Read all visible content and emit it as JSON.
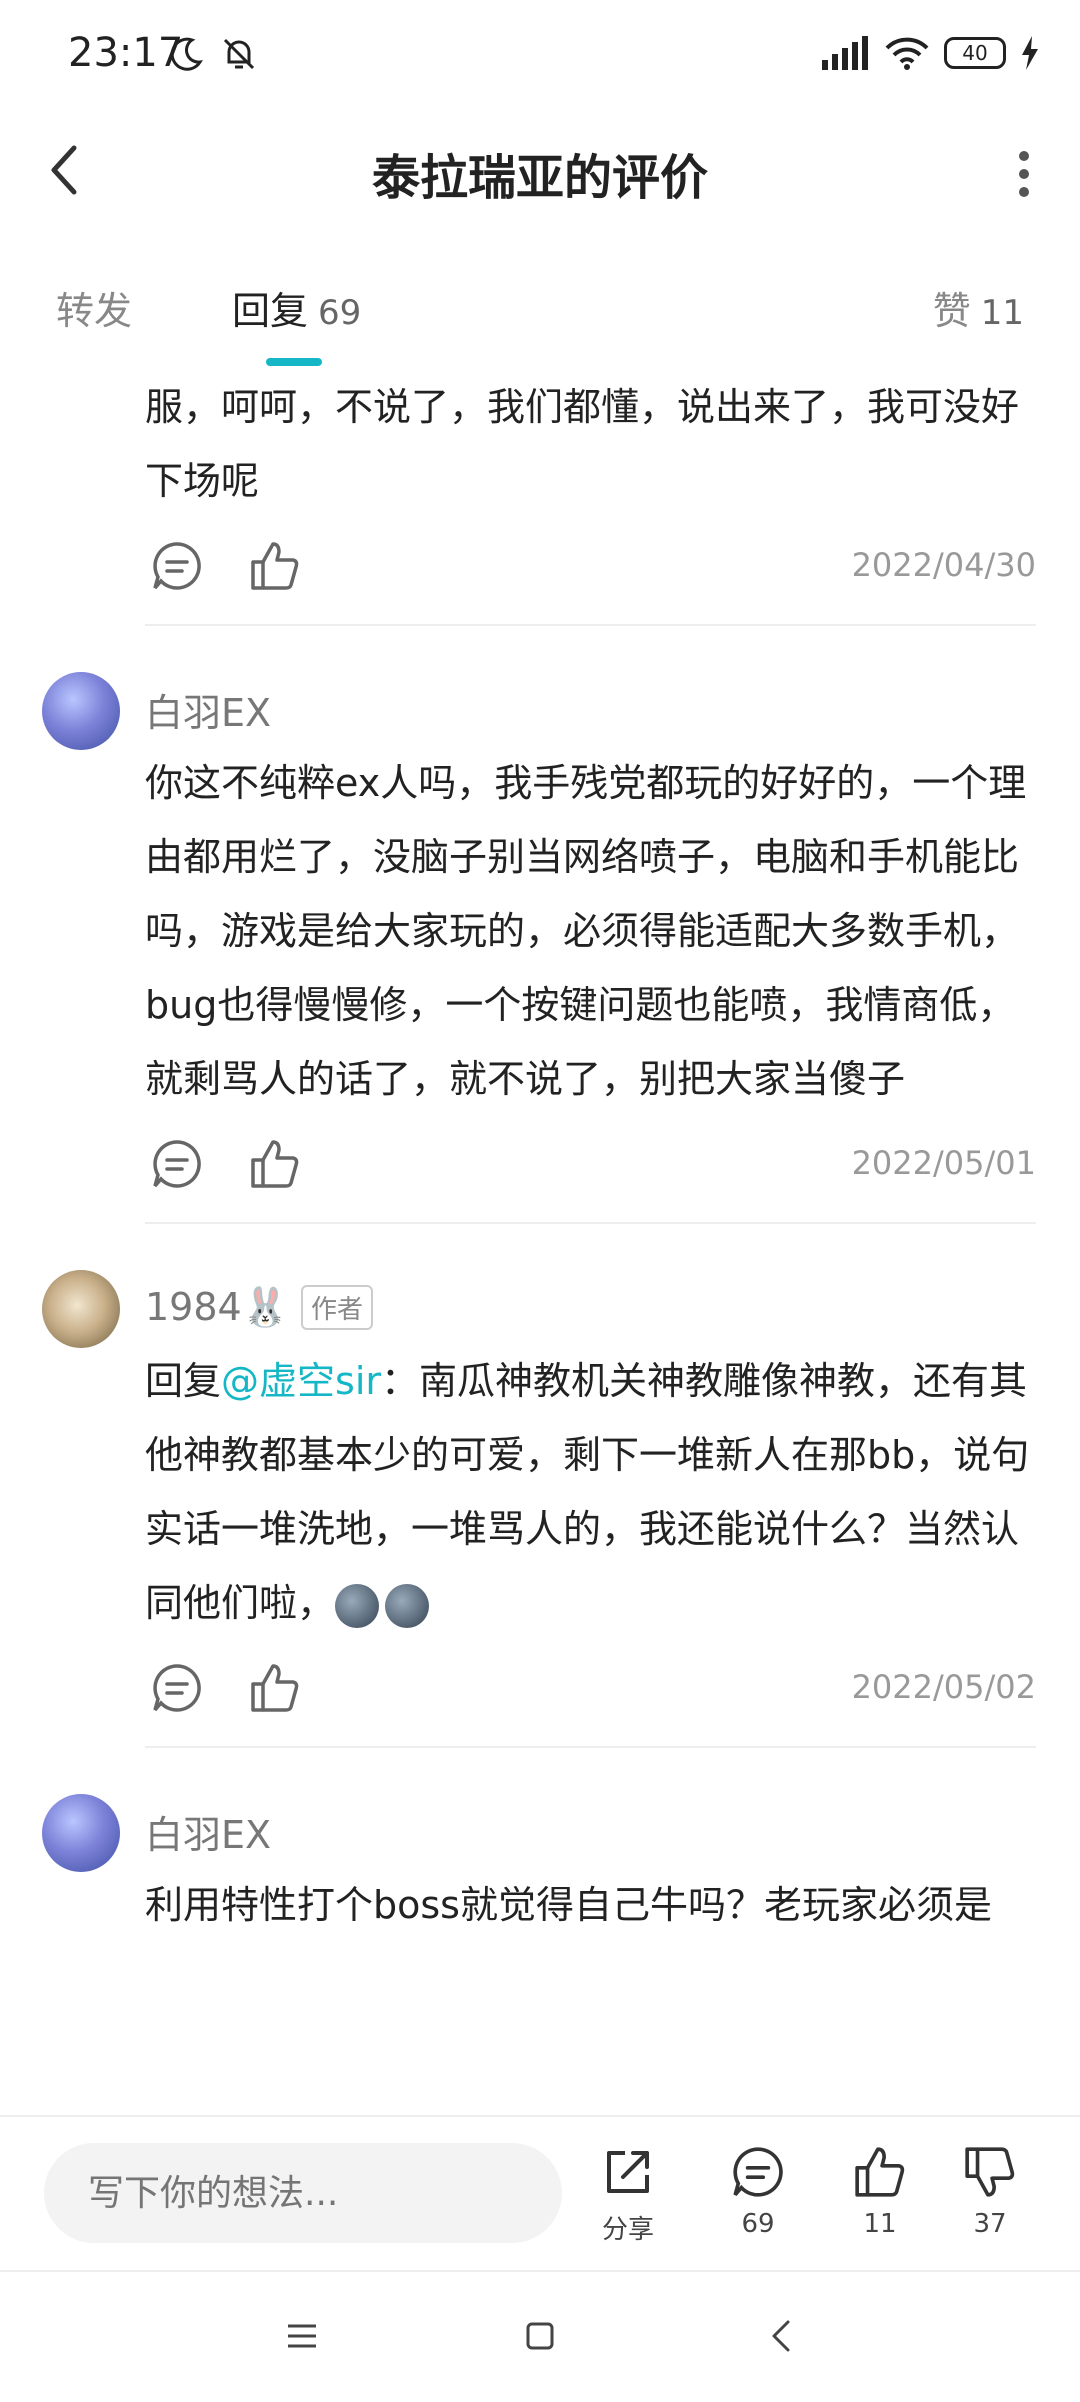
{
  "status_bar": {
    "time": "23:17",
    "battery": "40"
  },
  "header": {
    "title": "泰拉瑞亚的评价"
  },
  "tabs": [
    {
      "label": "转发",
      "count": ""
    },
    {
      "label": "回复",
      "count": "69"
    },
    {
      "label": "赞",
      "count": "11"
    }
  ],
  "comments": [
    {
      "text": "服，呵呵，不说了，我们都懂，说出来了，我可没好下场呢",
      "date": "2022/04/30"
    },
    {
      "username": "白羽EX",
      "text": "你这不纯粹ex人吗，我手残党都玩的好好的，一个理由都用烂了，没脑子别当网络喷子，电脑和手机能比吗，游戏是给大家玩的，必须得能适配大多数手机，bug也得慢慢修，一个按键问题也能喷，我情商低，就剩骂人的话了，就不说了，别把大家当傻子",
      "date": "2022/05/01"
    },
    {
      "username": "1984🐰",
      "badge": "作者",
      "reply_prefix": "回复",
      "mention": "@虚空sir",
      "text": "：南瓜神教机关神教雕像神教，还有其他神教都基本少的可爱，剩下一堆新人在那bb，说句实话一堆洗地，一堆骂人的，我还能说什么？当然认同他们啦，",
      "date": "2022/05/02"
    },
    {
      "username": "白羽EX",
      "text": "利用特性打个boss就觉得自己牛吗？老玩家必须是"
    }
  ],
  "bottom_bar": {
    "input_placeholder": "写下你的想法...",
    "share_label": "分享",
    "comments_count": "69",
    "likes_count": "11",
    "dislikes_count": "37"
  },
  "colors": {
    "accent": "#15b7c6"
  }
}
